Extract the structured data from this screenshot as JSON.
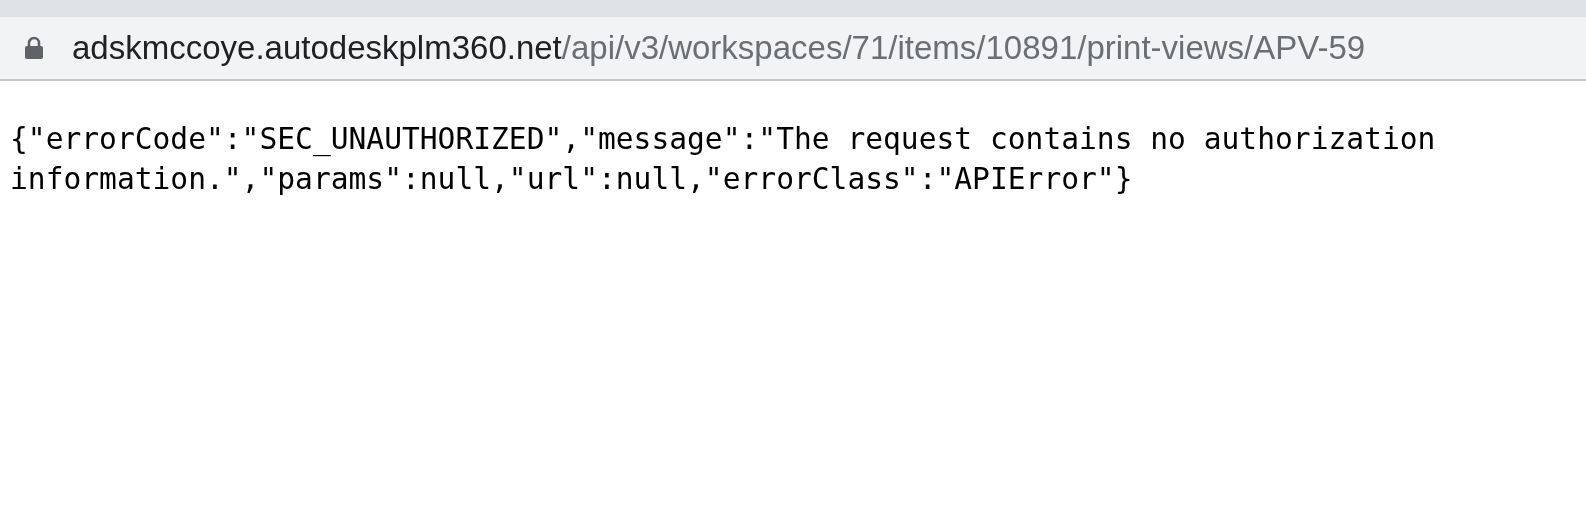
{
  "address_bar": {
    "host": "adskmccoye.autodeskplm360.net",
    "path": "/api/v3/workspaces/71/items/10891/print-views/APV-59"
  },
  "body": {
    "text": "{\"errorCode\":\"SEC_UNAUTHORIZED\",\"message\":\"The request contains no authorization information.\",\"params\":null,\"url\":null,\"errorClass\":\"APIError\"}"
  }
}
